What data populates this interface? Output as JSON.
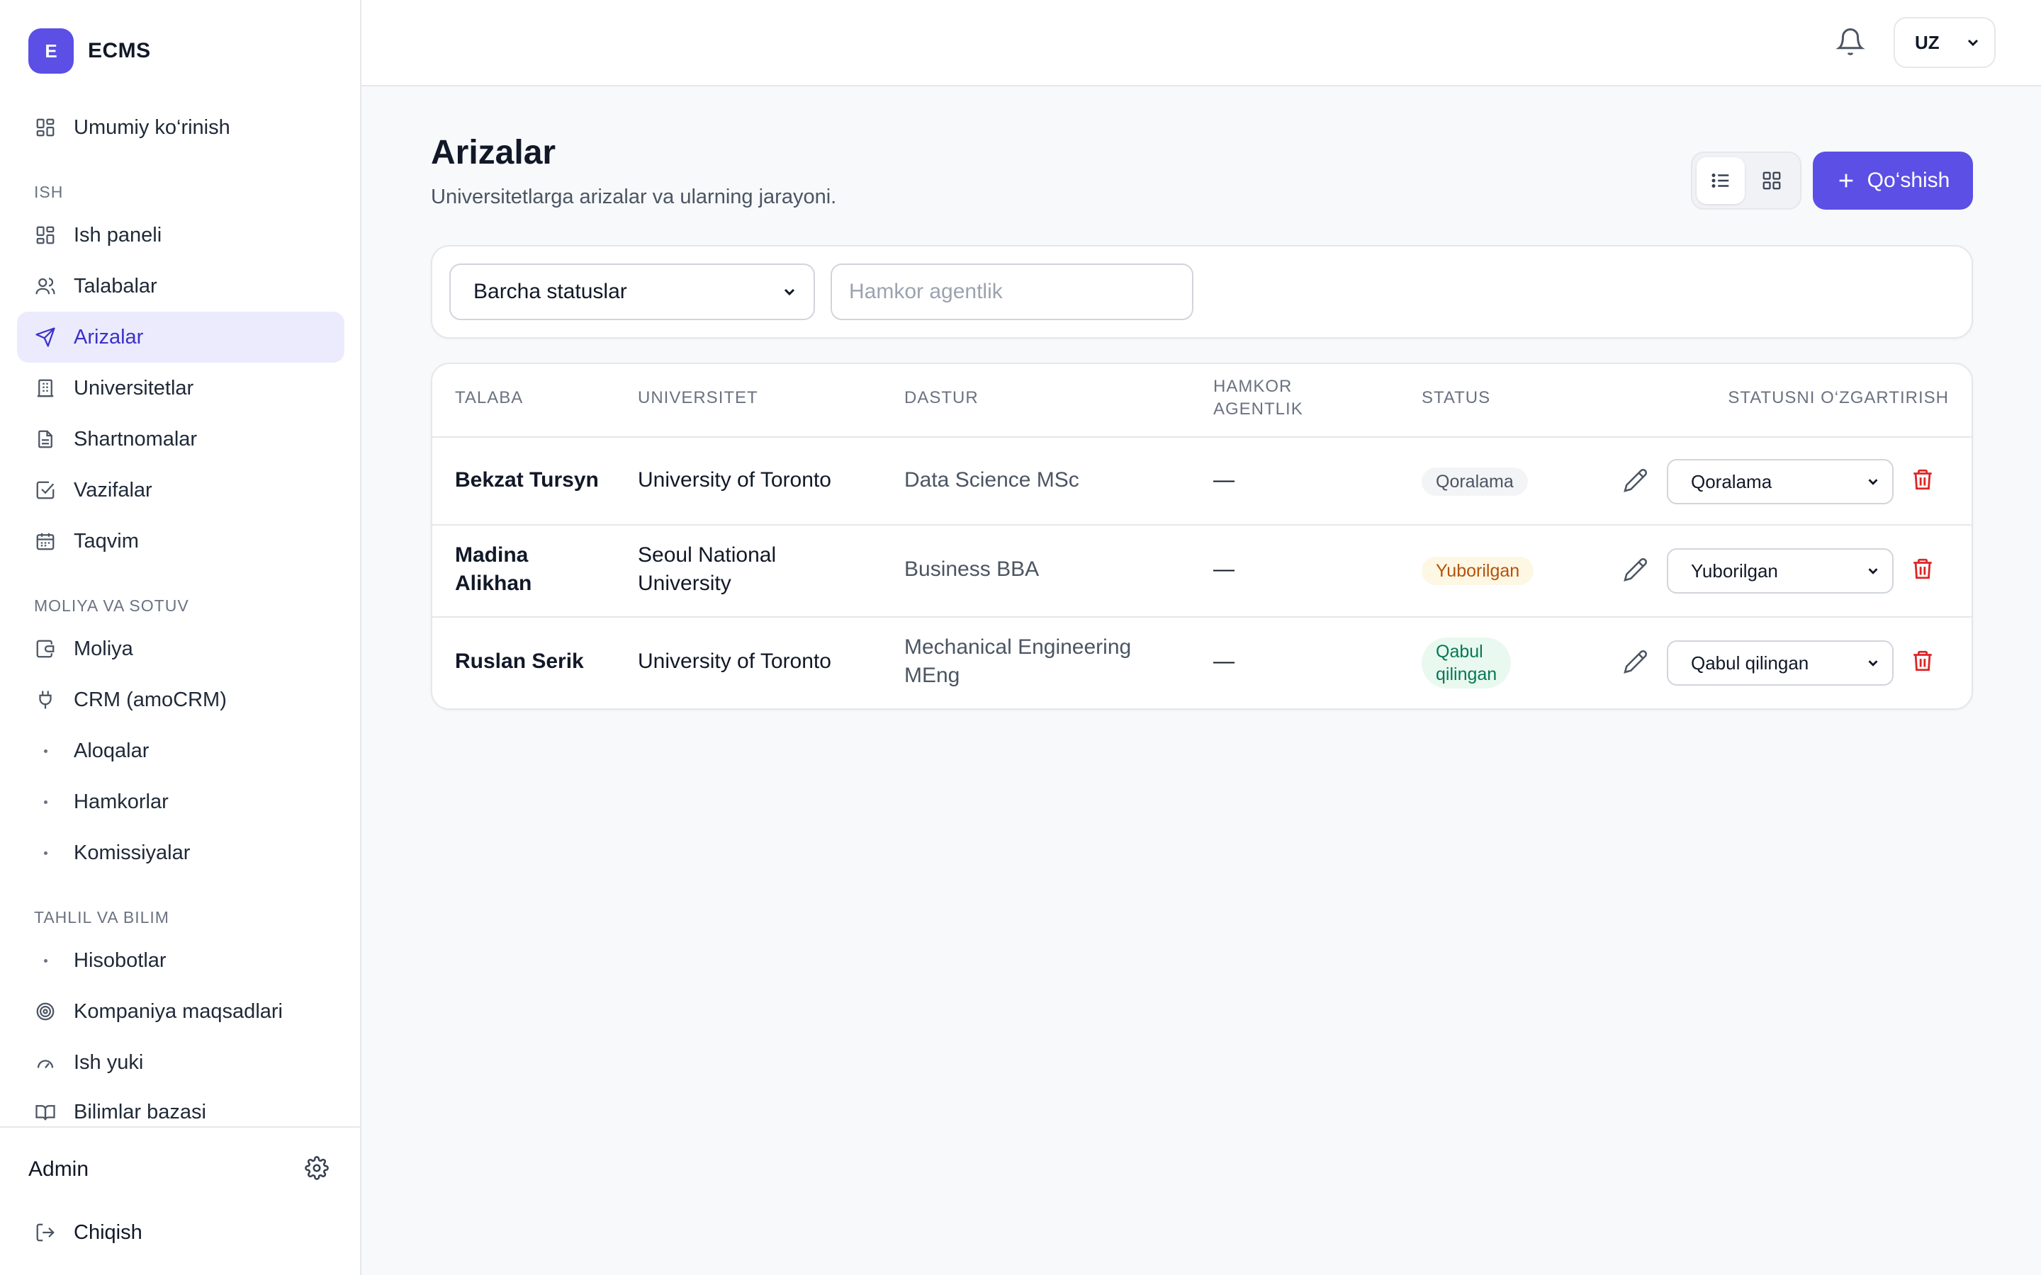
{
  "app": {
    "logo_letter": "E",
    "name": "ECMS"
  },
  "sidebar": {
    "overview": "Umumiy ko‘rinish",
    "sections": {
      "work": "ISH",
      "finance": "MOLIYA VA SOTUV",
      "analytics": "TAHLIL VA BILIM"
    },
    "work_items": [
      "Ish paneli",
      "Talabalar",
      "Arizalar",
      "Universitetlar",
      "Shartnomalar",
      "Vazifalar",
      "Taqvim"
    ],
    "finance_items": [
      "Moliya",
      "CRM (amoCRM)",
      "Aloqalar",
      "Hamkorlar",
      "Komissiyalar"
    ],
    "analytics_items": [
      "Hisobotlar",
      "Kompaniya maqsadlari",
      "Ish yuki",
      "Bilimlar bazasi"
    ],
    "active": "Arizalar",
    "user": "Admin",
    "logout": "Chiqish"
  },
  "topbar": {
    "language": "UZ"
  },
  "page": {
    "title": "Arizalar",
    "subtitle": "Universitetlarga arizalar va ularning jarayoni.",
    "add_button": "Qo‘shish"
  },
  "filters": {
    "status_select": "Barcha statuslar",
    "agency_placeholder": "Hamkor agentlik"
  },
  "table": {
    "headers": {
      "student": "TALABA",
      "university": "UNIVERSITET",
      "program": "DASTUR",
      "agency_1": "HAMKOR",
      "agency_2": "AGENTLIK",
      "status": "STATUS",
      "change_status": "STATUSNI O‘ZGARTIRISH"
    },
    "rows": [
      {
        "student_1": "Bekzat Tursyn",
        "student_2": "",
        "university_1": "University of Toronto",
        "university_2": "",
        "program_1": "Data Science MSc",
        "program_2": "",
        "agency": "—",
        "status_1": "Qoralama",
        "status_2": "",
        "select": "Qoralama",
        "status_color": "#4b5563",
        "status_bg": "#f3f4f6"
      },
      {
        "student_1": "Madina",
        "student_2": "Alikhan",
        "university_1": "Seoul National",
        "university_2": "University",
        "program_1": "Business BBA",
        "program_2": "",
        "agency": "—",
        "status_1": "Yuborilgan",
        "status_2": "",
        "select": "Yuborilgan",
        "status_color": "#b45309",
        "status_bg": "#fef7e4"
      },
      {
        "student_1": "Ruslan Serik",
        "student_2": "",
        "university_1": "University of Toronto",
        "university_2": "",
        "program_1": "Mechanical Engineering",
        "program_2": "MEng",
        "agency": "—",
        "status_1": "Qabul",
        "status_2": "qilingan",
        "select": "Qabul qilingan",
        "status_color": "#047857",
        "status_bg": "#e9f9ef"
      }
    ]
  },
  "icons": {
    "accent": "#5b4fe6",
    "danger": "#dc2626"
  }
}
